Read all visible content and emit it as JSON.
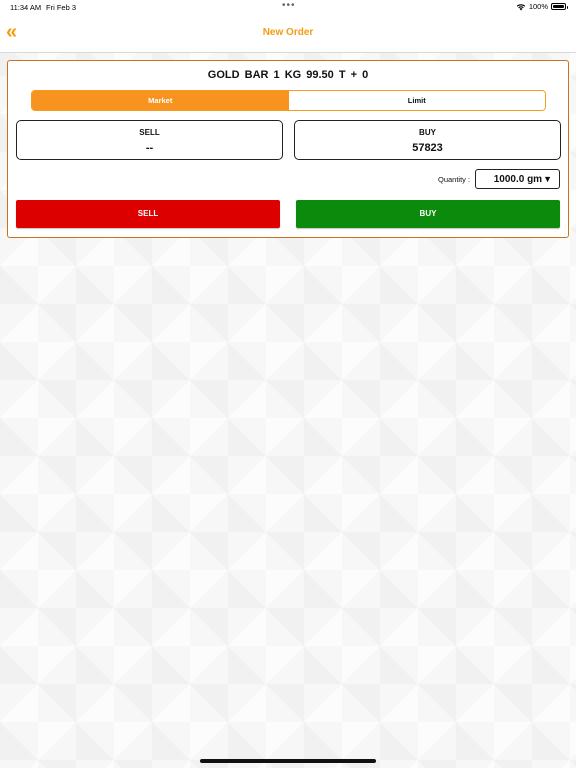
{
  "status_bar": {
    "time": "11:34 AM",
    "date": "Fri Feb 3",
    "dots": "•••",
    "battery": "100%",
    "wifi_icon": "wifi-icon",
    "battery_icon": "battery-icon"
  },
  "nav": {
    "back_icon": "double-chevron-left-icon",
    "back_glyph": "«",
    "title": "New Order"
  },
  "order": {
    "product_title": "GOLD  BAR  1 KG  99.50 T + 0",
    "order_types": [
      {
        "label": "Market",
        "active": true
      },
      {
        "label": "Limit",
        "active": false
      }
    ],
    "sell_box": {
      "label": "SELL",
      "value": "--"
    },
    "buy_box": {
      "label": "BUY",
      "value": "57823"
    },
    "quantity": {
      "label": "Quantity :",
      "value": "1000.0 gm",
      "arrow": "▼"
    },
    "sell_button": "SELL",
    "buy_button": "BUY"
  },
  "colors": {
    "accent": "#f39c12",
    "card_border": "#c8741e",
    "sell": "#dd0000",
    "buy": "#0b8a0b"
  }
}
